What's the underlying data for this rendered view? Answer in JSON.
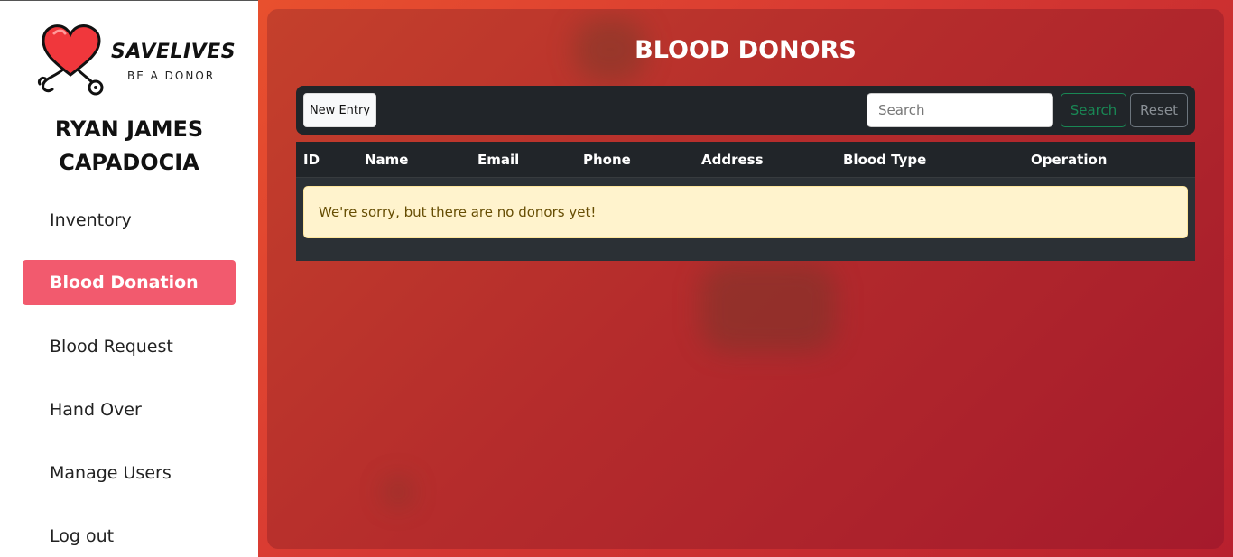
{
  "brand": {
    "name": "SAVELIVES",
    "tagline": "BE A DONOR"
  },
  "user": {
    "name_line1": "RYAN JAMES",
    "name_line2": "CAPADOCIA"
  },
  "sidebar": {
    "items": [
      {
        "label": "Inventory",
        "active": false
      },
      {
        "label": "Blood Donation",
        "active": true
      },
      {
        "label": "Blood Request",
        "active": false
      },
      {
        "label": "Hand Over",
        "active": false
      },
      {
        "label": "Manage Users",
        "active": false
      },
      {
        "label": "Log out",
        "active": false
      }
    ]
  },
  "main": {
    "title": "BLOOD DONORS",
    "toolbar": {
      "new_entry_label": "New Entry",
      "search_placeholder": "Search",
      "search_value": "",
      "search_label": "Search",
      "reset_label": "Reset"
    },
    "table": {
      "columns": [
        "ID",
        "Name",
        "Email",
        "Phone",
        "Address",
        "Blood Type",
        "Operation"
      ],
      "rows": [],
      "empty_message": "We're sorry, but there are no donors yet!"
    }
  },
  "colors": {
    "accent_active": "#f25a6e",
    "background_red": "#b52c2c",
    "table_dark": "#212529",
    "alert_bg": "#fff3cd",
    "success": "#198754"
  },
  "icons": {
    "logo": "heart-stethoscope-icon"
  }
}
